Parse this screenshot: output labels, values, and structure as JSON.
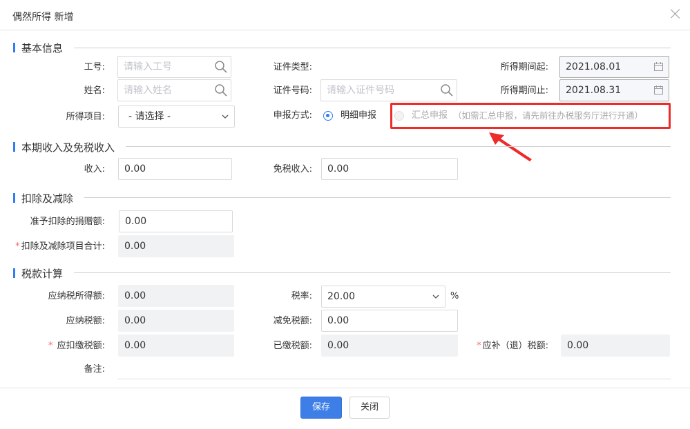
{
  "dialog": {
    "title": "偶然所得 新增"
  },
  "sections": {
    "basic": "基本信息",
    "income": "本期收入及免税收入",
    "deduction": "扣除及减除",
    "tax": "税款计算"
  },
  "basic": {
    "employee_no": {
      "label": "工号:",
      "placeholder": "请输入工号"
    },
    "name": {
      "label": "姓名:",
      "placeholder": "请输入姓名"
    },
    "income_item": {
      "label": "所得项目:",
      "value": "- 请选择 -"
    },
    "id_type": {
      "label": "证件类型:",
      "value": ""
    },
    "id_number": {
      "label": "证件号码:",
      "placeholder": "请输入证件号码"
    },
    "filing_method": {
      "label": "申报方式:",
      "option_detail": "明细申报",
      "option_summary": "汇总申报",
      "summary_note": "（如需汇总申报，请先前往办税服务厅进行开通）",
      "selected": "明细申报"
    },
    "period_start": {
      "label": "所得期间起:",
      "value": "2021.08.01"
    },
    "period_end": {
      "label": "所得期间止:",
      "value": "2021.08.31"
    }
  },
  "income": {
    "income": {
      "label": "收入:",
      "value": "0.00"
    },
    "tax_free_income": {
      "label": "免税收入:",
      "value": "0.00"
    }
  },
  "deduction": {
    "donation": {
      "label": "准予扣除的捐赠额:",
      "value": "0.00"
    },
    "total": {
      "label": "扣除及减除项目合计:",
      "value": "0.00",
      "required": "*"
    }
  },
  "tax": {
    "taxable_income": {
      "label": "应纳税所得额:",
      "value": "0.00"
    },
    "rate": {
      "label": "税率:",
      "value": "20.00",
      "unit": "%"
    },
    "tax_payable": {
      "label": "应纳税额:",
      "value": "0.00"
    },
    "tax_relief": {
      "label": "减免税额:",
      "value": "0.00"
    },
    "tax_withheld": {
      "label": "应扣缴税额:",
      "value": "0.00",
      "required": "*"
    },
    "tax_paid": {
      "label": "已缴税额:",
      "value": "0.00"
    },
    "tax_refund": {
      "label": "应补（退）税额:",
      "value": "0.00",
      "required": "*"
    },
    "remark": {
      "label": "备注:",
      "value": ""
    }
  },
  "footer": {
    "save": "保存",
    "close": "关闭"
  },
  "colors": {
    "accent": "#2f7cf6",
    "annotation": "#ee2a2a"
  }
}
